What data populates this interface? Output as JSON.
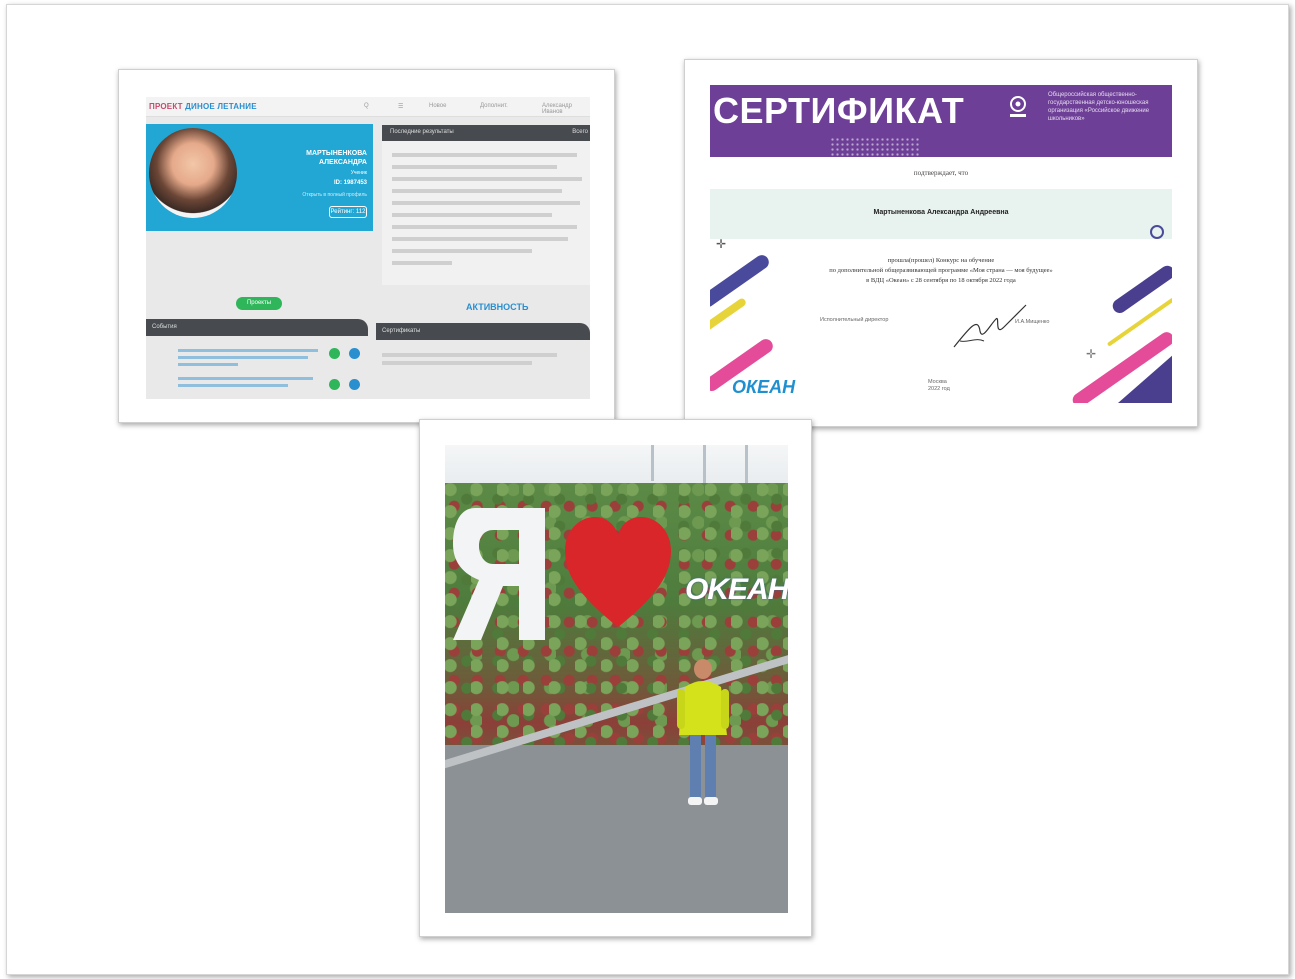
{
  "screenshot": {
    "logo_prefix": "ПРОЕКТ",
    "logo_main": "ДИНОЕ ЛЕТАНИЕ",
    "nav": [
      "Q",
      "☰",
      "Новое",
      "Дополнит.",
      "Александр Иванов"
    ],
    "profile_name_line1": "МАРТЫНЕНКОВА",
    "profile_name_line2": "АЛЕКСАНДРА",
    "profile_role": "Ученик",
    "profile_id": "ID: 1987453",
    "profile_link": "Открыть в полный профиль",
    "profile_button": "Рейтинг: 112",
    "panel_header": "Последние результаты",
    "panel_header_right": "Всего",
    "projects_button": "Проекты",
    "activity_label": "АКТИВНОСТЬ",
    "left_dark_label": "События",
    "right_dark_label": "Сертификаты"
  },
  "certificate": {
    "title": "СЕРТИФИКАТ",
    "org": "Общероссийская общественно-государственная детско-юношеская организация «Российское движение школьников»",
    "confirms": "подтверждает, что",
    "name": "Мартыненкова Александра Андреевна",
    "line1": "прошла(прошел) Конкурс на обучение",
    "line2": "по дополнительной общеразвивающей программе «Моя страна — моя будущее»",
    "line3": "в ВДЦ «Океан» с 28 сентября по 18 октября 2022 года",
    "signer_role": "Исполнительный директор",
    "signer_name": "И.А.Мищенко",
    "city": "Москва",
    "year": "2022 год",
    "logo": "ОКЕАН"
  },
  "photo": {
    "sign_letter": "Я",
    "sign_word": "OKEAH"
  },
  "colors": {
    "cert_purple": "#6d3f97",
    "screen_blue": "#22a6d3",
    "green": "#2fb55a",
    "heart_red": "#d8262b",
    "jacket": "#d4e21b"
  }
}
